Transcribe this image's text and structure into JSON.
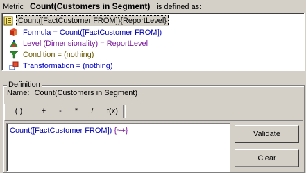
{
  "header": {
    "prefix": "Metric",
    "metric_name": "Count(Customers in Segment)",
    "suffix": "is defined as:"
  },
  "tree": {
    "root": {
      "label": "Count([FactCustomer FROM]){ReportLevel}",
      "icon": "metric-icon"
    },
    "children": [
      {
        "label": "Formula = Count([FactCustomer FROM])",
        "icon": "formula-icon",
        "color": "#0000b0"
      },
      {
        "label": "Level (Dimensionality) = ReportLevel",
        "icon": "level-icon",
        "color": "#7a1a9c"
      },
      {
        "label": "Condition = (nothing)",
        "icon": "condition-icon",
        "color": "#6b5a00"
      },
      {
        "label": "Transformation = (nothing)",
        "icon": "transformation-icon",
        "color": "#0000c8"
      }
    ]
  },
  "definition": {
    "group_title": "Definition",
    "name_label": "Name:",
    "name_value": "Count(Customers in Segment)",
    "toolbar": [
      "( )",
      "+",
      "-",
      "*",
      "/",
      "f(x)"
    ],
    "formula_text": "Count([FactCustomer FROM])",
    "formula_suffix": "{~+}",
    "validate_label": "Validate",
    "clear_label": "Clear"
  }
}
